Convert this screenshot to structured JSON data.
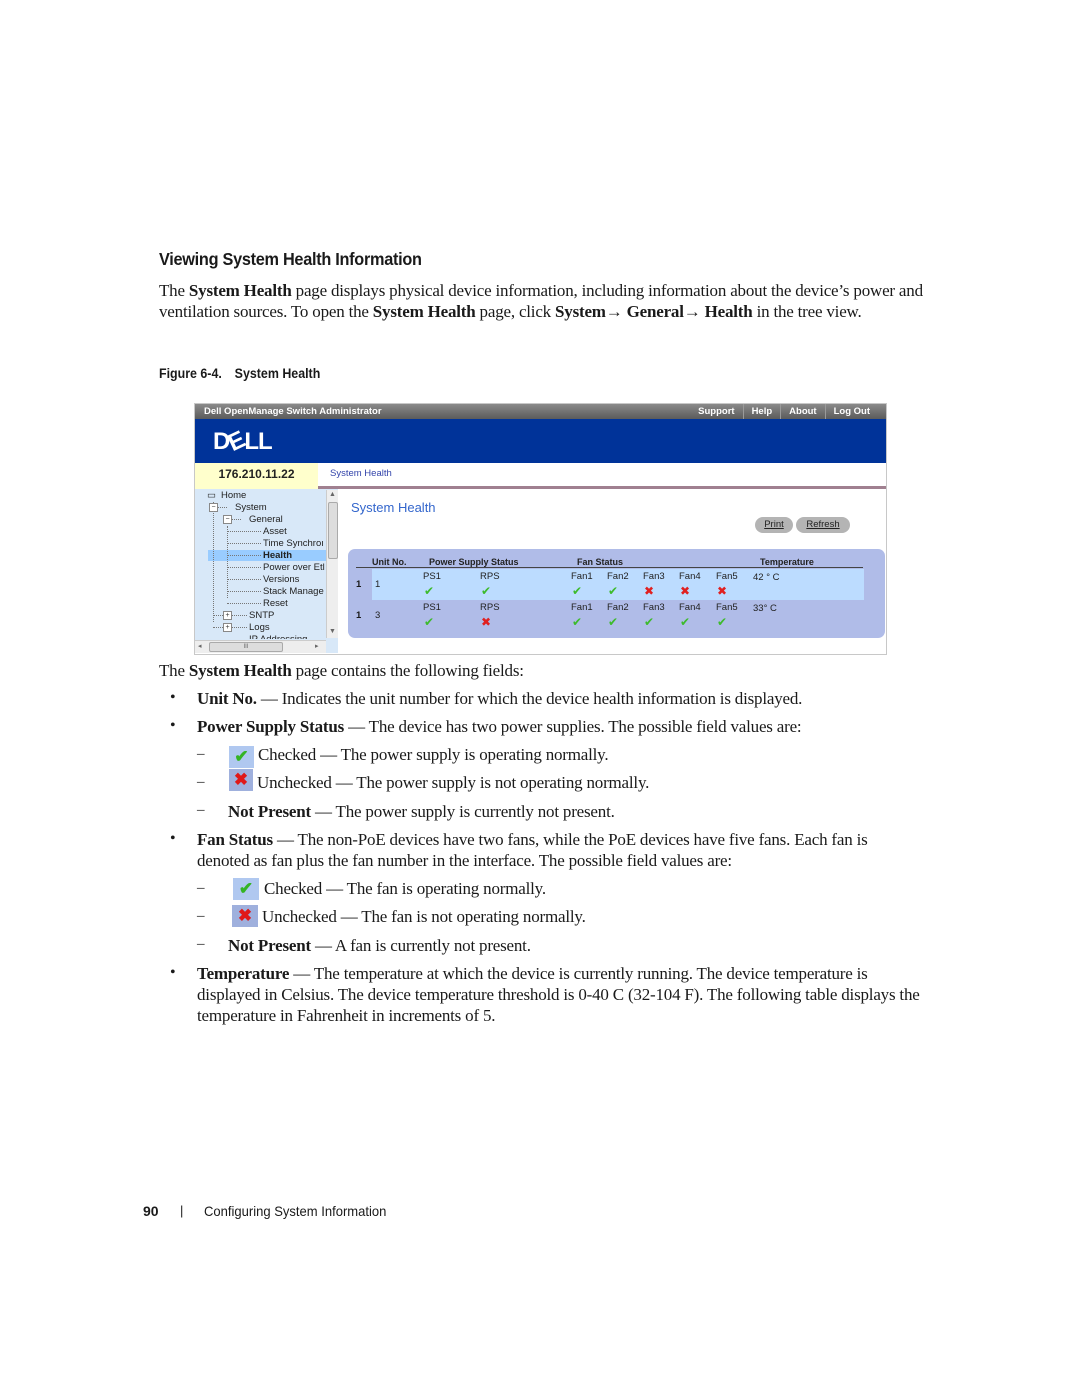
{
  "section_title": "Viewing System Health Information",
  "intro": {
    "t1": "The ",
    "b1": "System Health",
    "t2": " page displays physical device information, including information about the device’s power and ventilation sources. To open the ",
    "b2": "System Health",
    "t3": " page, click ",
    "b3": "System→ General→ Health",
    "t4": " in the tree view."
  },
  "figure": {
    "number": "Figure 6-4.",
    "caption": "System Health"
  },
  "app": {
    "title": "Dell OpenManage Switch Administrator",
    "top_links": [
      "Support",
      "Help",
      "About",
      "Log Out"
    ],
    "logo": "DELL",
    "ip": "176.210.11.22",
    "breadcrumb": "System Health",
    "tree": [
      {
        "label": "Home"
      },
      {
        "label": "System"
      },
      {
        "label": "General"
      },
      {
        "label": "Asset"
      },
      {
        "label": "Time Synchroı"
      },
      {
        "label": "Health"
      },
      {
        "label": "Power over Etl"
      },
      {
        "label": "Versions"
      },
      {
        "label": "Stack Manage"
      },
      {
        "label": "Reset"
      },
      {
        "label": "SNTP"
      },
      {
        "label": "Logs"
      },
      {
        "label": "IP Addressing"
      }
    ],
    "page_title": "System Health",
    "buttons": {
      "print": "Print",
      "refresh": "Refresh"
    },
    "table": {
      "headers": {
        "unit": "Unit No.",
        "power": "Power Supply Status",
        "fan": "Fan Status",
        "temp": "Temperature"
      },
      "rows": [
        {
          "index": "1",
          "unit": "1",
          "power_labels": [
            "PS1",
            "RPS"
          ],
          "power_status": [
            "ok",
            "ok"
          ],
          "fan_labels": [
            "Fan1",
            "Fan2",
            "Fan3",
            "Fan4",
            "Fan5"
          ],
          "fan_status": [
            "ok",
            "ok",
            "fail",
            "fail",
            "fail"
          ],
          "temperature": "42 ° C"
        },
        {
          "index": "1",
          "unit": "3",
          "power_labels": [
            "PS1",
            "RPS"
          ],
          "power_status": [
            "ok",
            "fail"
          ],
          "fan_labels": [
            "Fan1",
            "Fan2",
            "Fan3",
            "Fan4",
            "Fan5"
          ],
          "fan_status": [
            "ok",
            "ok",
            "ok",
            "ok",
            "ok"
          ],
          "temperature": "33° C"
        }
      ]
    }
  },
  "fields_intro": {
    "t1": "The ",
    "b1": "System Health",
    "t2": " page contains the following fields:"
  },
  "fields": {
    "unit": {
      "term": "Unit No.",
      "desc": " — Indicates the unit number for which the device health information is displayed."
    },
    "power": {
      "term": "Power Supply Status",
      "desc": " — The device has two power supplies. The possible field values are:",
      "values": [
        {
          "icon": "check-icon",
          "term": "Checked",
          "desc": " — The power supply is operating normally."
        },
        {
          "icon": "cross-icon",
          "term": "Unchecked",
          "desc": " — The power supply is not operating normally."
        },
        {
          "term": "Not Present",
          "desc": " — The power supply is currently not present."
        }
      ]
    },
    "fan": {
      "term": "Fan Status",
      "desc": " — The non-PoE devices have two fans, while the PoE devices have five fans. Each fan is denoted as fan plus the fan number in the interface. The possible field values are:",
      "values": [
        {
          "icon": "check-icon",
          "term": "Checked",
          "desc": " — The fan is operating normally."
        },
        {
          "icon": "cross-icon",
          "term": "Unchecked",
          "desc": " — The fan is not operating normally."
        },
        {
          "term": "Not Present",
          "desc": " — A fan is currently not present."
        }
      ]
    },
    "temp": {
      "term": "Temperature",
      "desc": " — The temperature at which the device is currently running. The device temperature is displayed in Celsius. The device temperature threshold is 0-40 C (32-104 F). The following table displays the temperature in Fahrenheit in increments of 5."
    }
  },
  "symbols": {
    "bullet": "•",
    "dash": "–",
    "check": "✔",
    "cross": "✖",
    "scroll_up": "▲",
    "scroll_down": "▼",
    "scroll_left": "◂",
    "scroll_right": "▸",
    "grip": "III",
    "plus": "+",
    "minus": "−"
  },
  "footer": {
    "page_number": "90",
    "separator": "|",
    "chapter": "Configuring System Information"
  },
  "colors": {
    "banner": "#003399",
    "ok": "#3dbb2c",
    "fail": "#e02020",
    "panel": "#b0bce8",
    "row_highlight": "#bcdcff",
    "link": "#3366cc"
  }
}
